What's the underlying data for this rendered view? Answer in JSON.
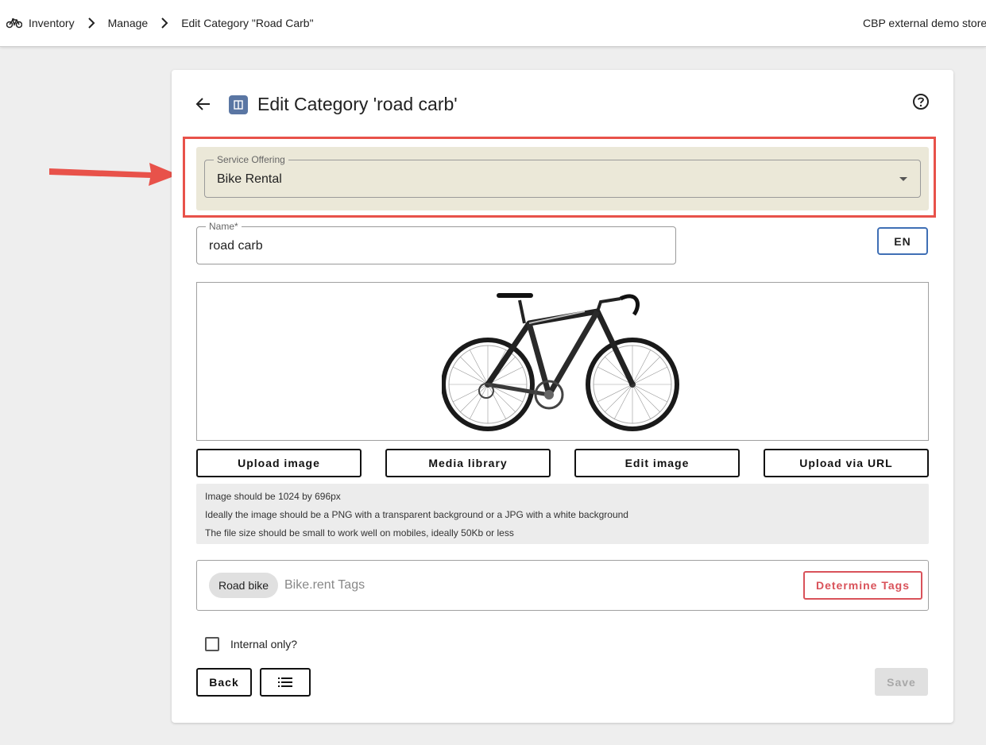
{
  "breadcrumb": {
    "items": [
      "Inventory",
      "Manage",
      "Edit Category \"Road Carb\""
    ]
  },
  "header": {
    "store_name": "CBP external demo store"
  },
  "page": {
    "title": "Edit Category 'road carb'"
  },
  "service_offering": {
    "label": "Service Offering",
    "value": "Bike Rental"
  },
  "name_field": {
    "label": "Name*",
    "value": "road carb"
  },
  "language_button": "EN",
  "image_buttons": {
    "upload": "Upload image",
    "media": "Media library",
    "edit": "Edit image",
    "url": "Upload via URL"
  },
  "image_info": [
    "Image should be 1024 by 696px",
    "Ideally the image should be a PNG with a transparent background or a JPG with a white background",
    "The file size should be small to work well on mobiles, ideally 50Kb or less"
  ],
  "tags": {
    "chips": [
      "Road bike"
    ],
    "placeholder": "Bike.rent Tags",
    "determine_button": "Determine Tags"
  },
  "internal_only": {
    "label": "Internal only?",
    "checked": false
  },
  "footer": {
    "back_label": "Back",
    "save_label": "Save"
  },
  "colors": {
    "highlight": "#e8524a",
    "service_panel_bg": "#ebe8d8",
    "language_border": "#3f6fb5",
    "determine_tags": "#d9525a",
    "title_icon_bg": "#5a76a3"
  },
  "icons": {
    "logo": "bicycle-icon",
    "back": "arrow-left-icon",
    "title": "category-book-icon",
    "help": "help-circle-icon",
    "dropdown": "caret-down-icon",
    "list": "list-icon"
  }
}
